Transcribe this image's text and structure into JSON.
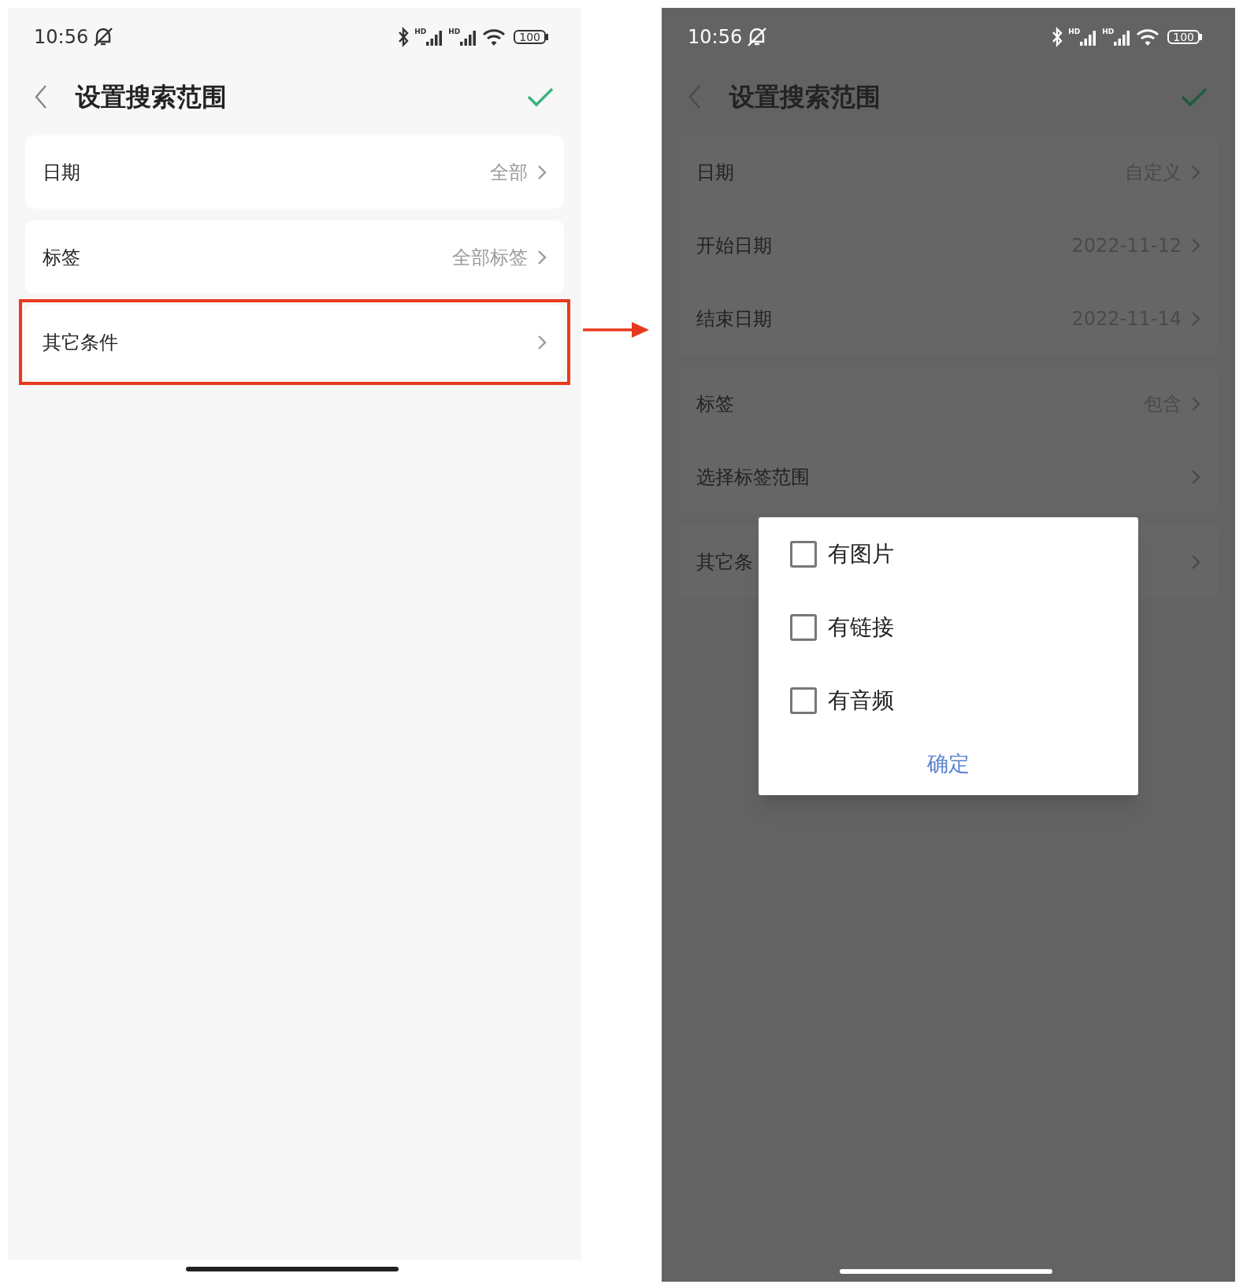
{
  "screens": [
    {
      "kind": "light",
      "status_bar": {
        "time": "10:56",
        "signal_labels": [
          "HD",
          "HD"
        ],
        "battery": "100"
      },
      "title": "设置搜索范围",
      "groups": [
        {
          "highlighted": false,
          "rows": [
            {
              "label": "日期",
              "value": "全部"
            }
          ]
        },
        {
          "highlighted": false,
          "rows": [
            {
              "label": "标签",
              "value": "全部标签"
            }
          ]
        },
        {
          "highlighted": true,
          "rows": [
            {
              "label": "其它条件"
            }
          ]
        }
      ]
    },
    {
      "kind": "dimmed",
      "status_bar": {
        "time": "10:56",
        "signal_labels": [
          "HD",
          "HD"
        ],
        "battery": "100"
      },
      "title": "设置搜索范围",
      "groups": [
        {
          "highlighted": false,
          "rows": [
            {
              "label": "日期",
              "value": "自定义"
            },
            {
              "label": "开始日期",
              "value": "2022-11-12"
            },
            {
              "label": "结束日期",
              "value": "2022-11-14"
            }
          ]
        },
        {
          "highlighted": false,
          "rows": [
            {
              "label": "标签",
              "value": "包含"
            },
            {
              "label": "选择标签范围"
            }
          ]
        },
        {
          "highlighted": false,
          "rows": [
            {
              "label": "其它条"
            }
          ]
        }
      ],
      "dialog": {
        "options": [
          {
            "label": "有图片",
            "checked": false
          },
          {
            "label": "有链接",
            "checked": false
          },
          {
            "label": "有音频",
            "checked": false
          }
        ],
        "button": "确定"
      }
    }
  ]
}
